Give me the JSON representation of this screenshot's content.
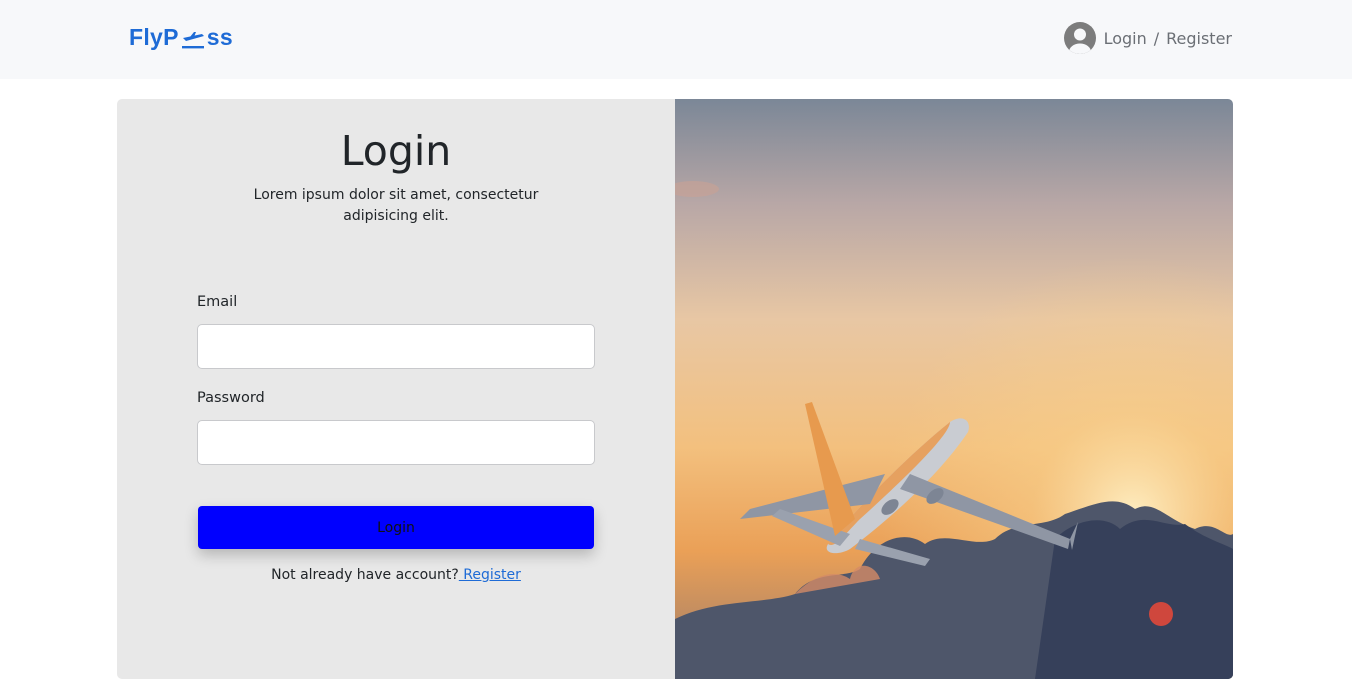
{
  "header": {
    "logo_part1": "FlyP",
    "logo_part2": "ss",
    "account_icon": "user-circle-icon",
    "login_link": "Login",
    "separator": "/",
    "register_link": "Register"
  },
  "form": {
    "title": "Login",
    "subtitle": "Lorem ipsum dolor sit amet, consectetur adipisicing elit.",
    "email_label": "Email",
    "email_value": "",
    "password_label": "Password",
    "password_value": "",
    "submit_label": "Login",
    "register_prompt": "Not already have account?",
    "register_link": " Register"
  },
  "colors": {
    "brand": "#1e6bd6",
    "button": "#0000ff",
    "form_panel": "#e8e8e8"
  }
}
